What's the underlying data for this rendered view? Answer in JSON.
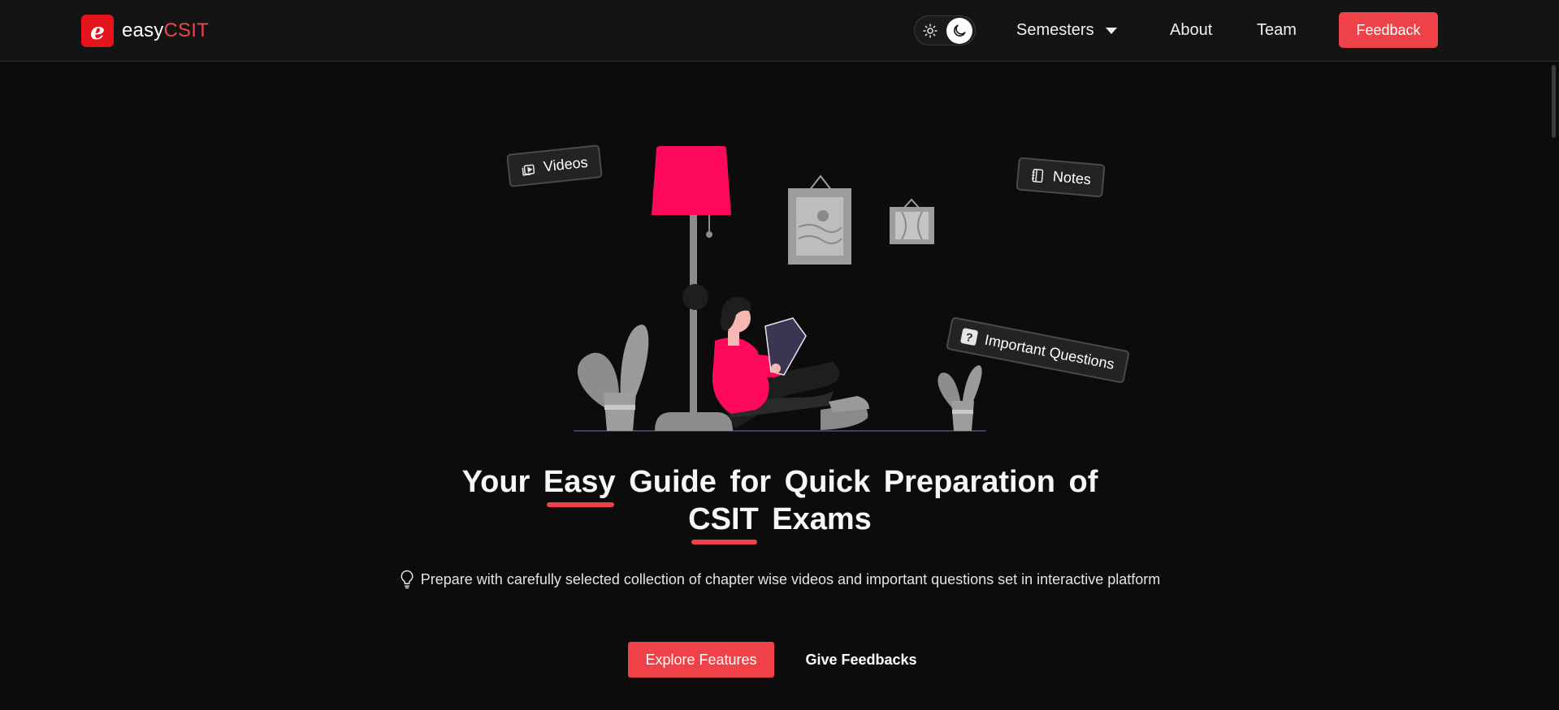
{
  "brand": {
    "logo_letter": "e",
    "name_prefix": "easy",
    "name_accent": "CSIT"
  },
  "nav": {
    "theme_toggle": {
      "light_icon": "sun-icon",
      "dark_icon": "moon-icon",
      "active": "dark"
    },
    "semesters_label": "Semesters",
    "about_label": "About",
    "team_label": "Team",
    "feedback_label": "Feedback"
  },
  "illustration": {
    "chips": {
      "videos": "Videos",
      "notes": "Notes",
      "important_questions": "Important Questions"
    },
    "question_mark": "?"
  },
  "hero": {
    "title": {
      "part1": "Your",
      "highlight1": "Easy",
      "part2": "Guide for Quick Preparation of",
      "highlight2": "CSIT",
      "part3": "Exams"
    },
    "subtitle": "Prepare with carefully selected collection of chapter wise videos and important questions set in interactive platform",
    "explore_label": "Explore Features",
    "give_feedback_label": "Give Feedbacks"
  },
  "colors": {
    "accent": "#ee4248",
    "logo_red": "#e5141c",
    "lamp_pink": "#ff0a5b",
    "background": "#0c0c0c",
    "header": "#141414"
  }
}
